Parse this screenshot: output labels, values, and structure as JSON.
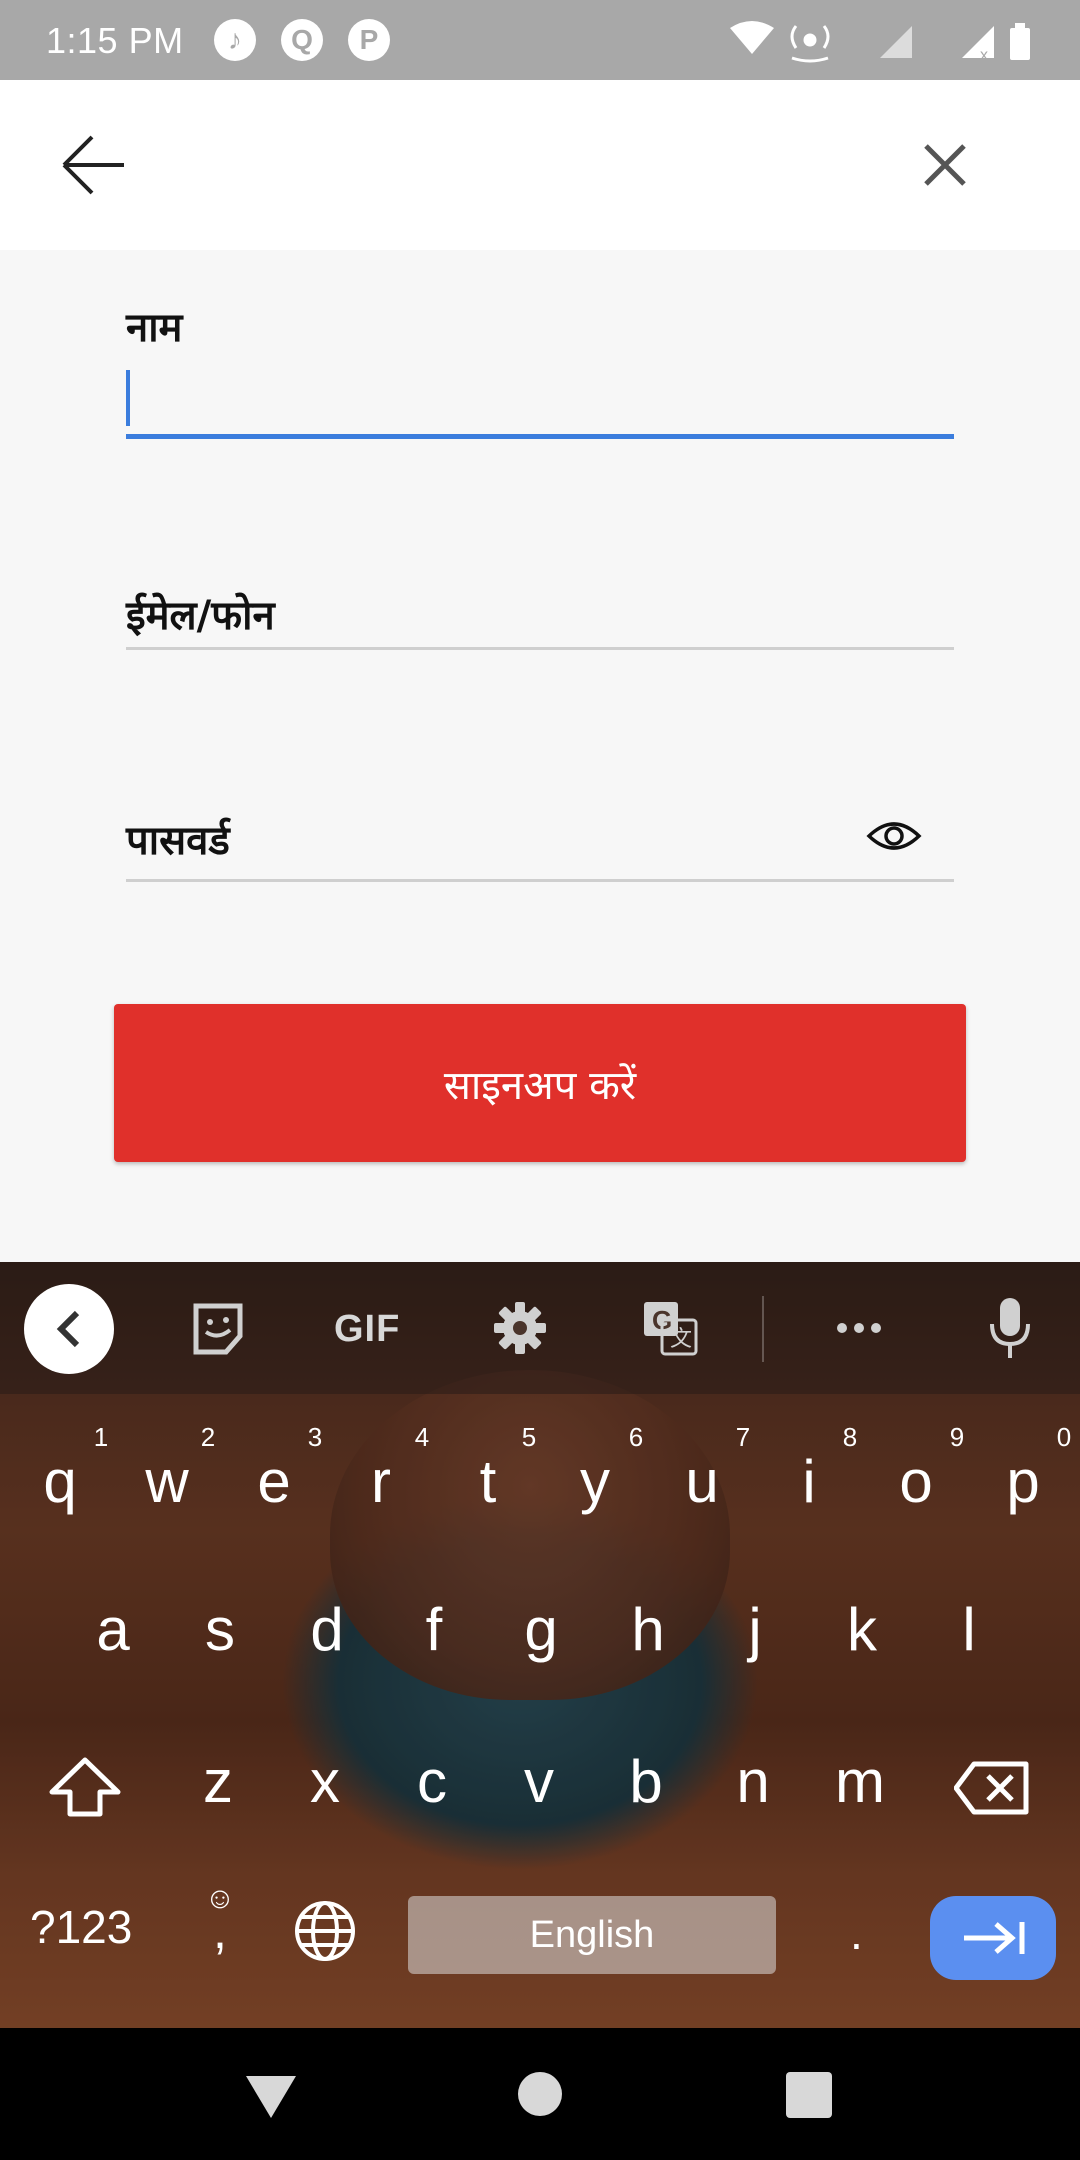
{
  "status_bar": {
    "time": "1:15 PM"
  },
  "form": {
    "name_label": "नाम",
    "name_value": "",
    "email_label": "ईमेल/फोन",
    "password_label": "पासवर्ड",
    "signup_label": "साइनअप करें"
  },
  "keyboard": {
    "toolbar": {
      "gif_label": "GIF"
    },
    "row1": [
      {
        "key": "q",
        "hint": "1"
      },
      {
        "key": "w",
        "hint": "2"
      },
      {
        "key": "e",
        "hint": "3"
      },
      {
        "key": "r",
        "hint": "4"
      },
      {
        "key": "t",
        "hint": "5"
      },
      {
        "key": "y",
        "hint": "6"
      },
      {
        "key": "u",
        "hint": "7"
      },
      {
        "key": "i",
        "hint": "8"
      },
      {
        "key": "o",
        "hint": "9"
      },
      {
        "key": "p",
        "hint": "0"
      }
    ],
    "row2": [
      "a",
      "s",
      "d",
      "f",
      "g",
      "h",
      "j",
      "k",
      "l"
    ],
    "row3": [
      "z",
      "x",
      "c",
      "v",
      "b",
      "n",
      "m"
    ],
    "symbols_label": "?123",
    "comma_label": ",",
    "space_label": "English",
    "period_label": "."
  },
  "colors": {
    "accent": "#3b7ddd",
    "signup": "#e0302b",
    "enter_key": "#5b8ff0"
  }
}
